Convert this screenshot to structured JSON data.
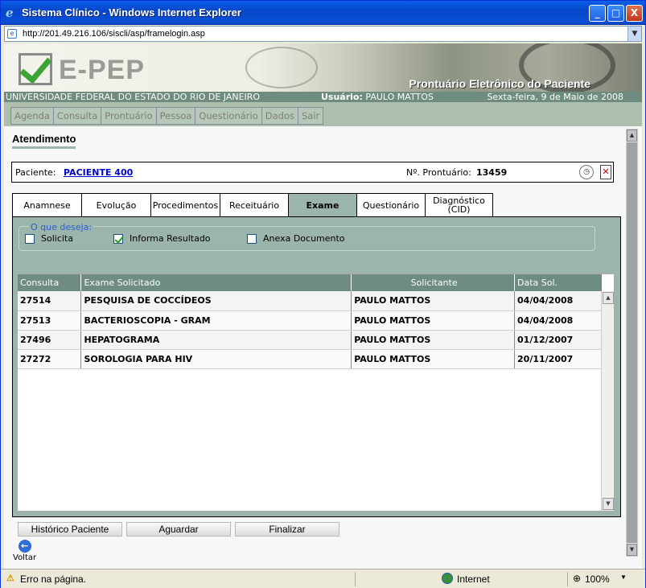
{
  "window": {
    "title": "Sistema Clínico - Windows Internet Explorer",
    "url": "http://201.49.216.106/siscli/asp/framelogin.asp",
    "min_label": "_",
    "max_label": "□",
    "close_label": "X"
  },
  "banner": {
    "logo": "E-PEP",
    "subtitle": "Prontuário Eletrônico do Paciente",
    "university": "UNIVERSIDADE FEDERAL DO ESTADO DO RIO DE JANEIRO",
    "user_label": "Usuário:",
    "user_name": "PAULO MATTOS",
    "date": "Sexta-feira, 9 de Maio de 2008"
  },
  "menu": [
    "Agenda",
    "Consulta",
    "Prontuário",
    "Pessoa",
    "Questionário",
    "Dados",
    "Sair"
  ],
  "page": {
    "title": "Atendimento",
    "patient_label": "Paciente:",
    "patient_name": "PACIENTE 400",
    "record_label": "Nº. Prontuário:",
    "record_value": "13459"
  },
  "tabs": [
    {
      "label": "Anamnese",
      "active": false
    },
    {
      "label": "Evolução",
      "active": false
    },
    {
      "label": "Procedimentos",
      "active": false
    },
    {
      "label": "Receituário",
      "active": false
    },
    {
      "label": "Exame",
      "active": true
    },
    {
      "label": "Questionário",
      "active": false
    },
    {
      "label": "Diagnóstico (CID)",
      "active": false
    }
  ],
  "options": {
    "legend": "O que deseja:",
    "items": [
      {
        "label": "Solicita",
        "checked": false
      },
      {
        "label": "Informa Resultado",
        "checked": true
      },
      {
        "label": "Anexa Documento",
        "checked": false
      }
    ]
  },
  "table": {
    "headers": [
      "Consulta",
      "Exame Solicitado",
      "Solicitante",
      "Data Sol."
    ],
    "rows": [
      [
        "27514",
        "PESQUISA DE COCCÍDEOS",
        "PAULO MATTOS",
        "04/04/2008"
      ],
      [
        "27513",
        "BACTERIOSCOPIA - GRAM",
        "PAULO MATTOS",
        "04/04/2008"
      ],
      [
        "27496",
        "HEPATOGRAMA",
        "PAULO MATTOS",
        "01/12/2007"
      ],
      [
        "27272",
        "SOROLOGIA PARA HIV",
        "PAULO MATTOS",
        "20/11/2007"
      ]
    ]
  },
  "buttons": {
    "history": "Histórico Paciente",
    "wait": "Aguardar",
    "finish": "Finalizar",
    "back": "Voltar"
  },
  "status": {
    "text": "Erro na página.",
    "zone": "Internet",
    "zoom": "100%"
  }
}
